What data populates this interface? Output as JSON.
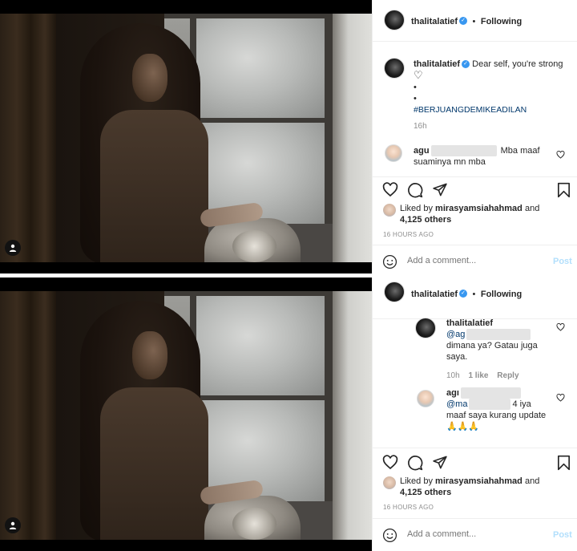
{
  "post1": {
    "header": {
      "username": "thalitalatief",
      "separator": "•",
      "follow_status": "Following"
    },
    "caption": {
      "username": "thalitalatief",
      "text": "Dear self, you're strong",
      "heart": "♡",
      "bullet1": "•",
      "bullet2": "•",
      "hashtag": "#BERJUANGDEMIKEADILAN",
      "time": "16h"
    },
    "comment": {
      "username_prefix": "agu",
      "text_line1": "Mba maaf",
      "text_line2": "suaminya mn mba"
    },
    "likes": {
      "liked_by_prefix": "Liked by",
      "liked_by_user": "mirasyamsiahahmad",
      "and": "and",
      "others": "4,125 others"
    },
    "timestamp": "16 HOURS AGO",
    "add_comment": {
      "placeholder": "Add a comment...",
      "post_label": "Post"
    }
  },
  "post2": {
    "header": {
      "username": "thalitalatief",
      "separator": "•",
      "follow_status": "Following"
    },
    "reply1": {
      "username": "thalitalatief",
      "mention_prefix": "@ag",
      "text_line2": "dimana ya? Gatau juga",
      "text_line3": "saya.",
      "time": "10h",
      "likes": "1 like",
      "reply_label": "Reply"
    },
    "reply2": {
      "username_prefix": "agı",
      "mention_prefix": "@ma",
      "mention_suffix": "4 iya",
      "text_line2": "maaf saya kurang update",
      "emoji": "🙏🙏🙏"
    },
    "likes": {
      "liked_by_prefix": "Liked by",
      "liked_by_user": "mirasyamsiahahmad",
      "and": "and",
      "others": "4,125 others"
    },
    "timestamp": "16 HOURS AGO",
    "add_comment": {
      "placeholder": "Add a comment...",
      "post_label": "Post"
    }
  },
  "colors": {
    "verified": "#3897f0",
    "hashtag": "#00376b",
    "post_disabled": "#b2dffc",
    "meta": "#8e8e8e"
  },
  "icons": [
    "heart-icon",
    "comment-icon",
    "share-icon",
    "bookmark-icon",
    "emoji-icon",
    "user-tag-icon",
    "verified-icon"
  ]
}
